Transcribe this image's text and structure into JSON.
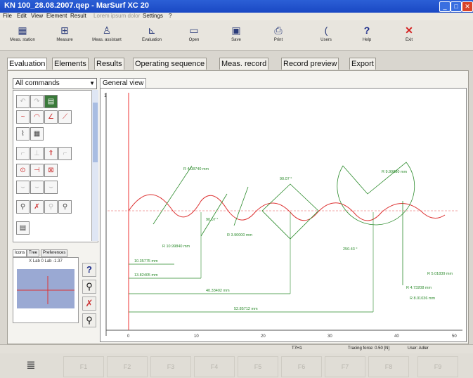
{
  "window": {
    "title": "KN 100_28.08.2007.qep - MarSurf XC 20"
  },
  "menu": [
    "File",
    "Edit",
    "View",
    "Element",
    "Result",
    "Settings",
    "?"
  ],
  "toolbar": [
    {
      "label": "Meas. station",
      "icon": "meas-station-icon",
      "glyph": "▦"
    },
    {
      "label": "Measure",
      "icon": "measure-icon",
      "glyph": "⊞"
    },
    {
      "label": "Meas. assistant",
      "icon": "meas-assistant-icon",
      "glyph": "♙"
    },
    {
      "label": "Evaluation",
      "icon": "evaluation-icon",
      "glyph": "⊾"
    },
    {
      "label": "Open",
      "icon": "open-folder-icon",
      "glyph": "▭"
    },
    {
      "label": "Save",
      "icon": "save-disk-icon",
      "glyph": "▣"
    },
    {
      "label": "Print",
      "icon": "print-icon",
      "glyph": "⎙"
    },
    {
      "label": "Users",
      "icon": "users-icon",
      "glyph": "("
    },
    {
      "label": "Help",
      "icon": "help-icon",
      "glyph": "?"
    },
    {
      "label": "Exit",
      "icon": "exit-icon",
      "glyph": "✕"
    }
  ],
  "tabs": [
    "Evaluation",
    "Elements",
    "Results",
    "Operating sequence",
    "Meas. record",
    "Record preview",
    "Export"
  ],
  "commands": {
    "selected": "All commands"
  },
  "subtabs": [
    "Icons",
    "Tree",
    "Preferences"
  ],
  "preview": {
    "title": "X Lab 0 Lab -1.37"
  },
  "general_view_tab": "General view",
  "graph": {
    "x_ticks": [
      "0",
      "10",
      "20",
      "30",
      "40",
      "50"
    ],
    "y_tick": "1",
    "annotations": [
      "R 4.08740 mm",
      "90.07 °",
      "R 10.99840 mm",
      "90.07 °",
      "R 9.99880 mm",
      "R 3.90000 mm",
      "250.43 °",
      "10.35775 mm",
      "13.82405 mm",
      "40.33402 mm",
      "R 4.73208 mm",
      "52.85712 mm",
      "R 5.01839 mm",
      "R 8.01036 mm"
    ]
  },
  "status": {
    "left": "T7H1",
    "tracing": "Tracing force: 0.50 [N]",
    "user": "User: Adler"
  },
  "fkeys": [
    "F1",
    "F2",
    "F3",
    "F4",
    "F5",
    "F6",
    "F7",
    "F8",
    "F9"
  ]
}
